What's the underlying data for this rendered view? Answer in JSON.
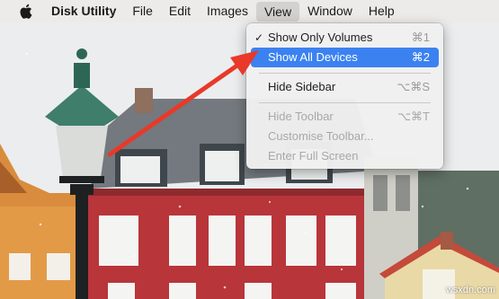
{
  "menubar": {
    "app_name": "Disk Utility",
    "items": [
      "File",
      "Edit",
      "Images",
      "View",
      "Window",
      "Help"
    ],
    "active_item": "View"
  },
  "view_menu": {
    "items": [
      {
        "label": "Show Only Volumes",
        "shortcut": "⌘1",
        "checked": true,
        "state": "enabled"
      },
      {
        "label": "Show All Devices",
        "shortcut": "⌘2",
        "checked": false,
        "state": "highlighted"
      },
      {
        "label": "Hide Sidebar",
        "shortcut": "⌥⌘S",
        "checked": false,
        "state": "enabled"
      },
      {
        "label": "Hide Toolbar",
        "shortcut": "⌥⌘T",
        "checked": false,
        "state": "disabled"
      },
      {
        "label": "Customise Toolbar...",
        "shortcut": "",
        "checked": false,
        "state": "disabled"
      },
      {
        "label": "Enter Full Screen",
        "shortcut": "",
        "checked": false,
        "state": "disabled"
      }
    ],
    "check_glyph": "✓"
  },
  "annotation": {
    "arrow_color": "#e8392a"
  },
  "watermark": "wsxdn.com",
  "colors": {
    "highlight": "#3b82f0",
    "building_red": "#b8353a",
    "roof_gray": "#6f7479",
    "lamp_green": "#3e7e6a"
  }
}
